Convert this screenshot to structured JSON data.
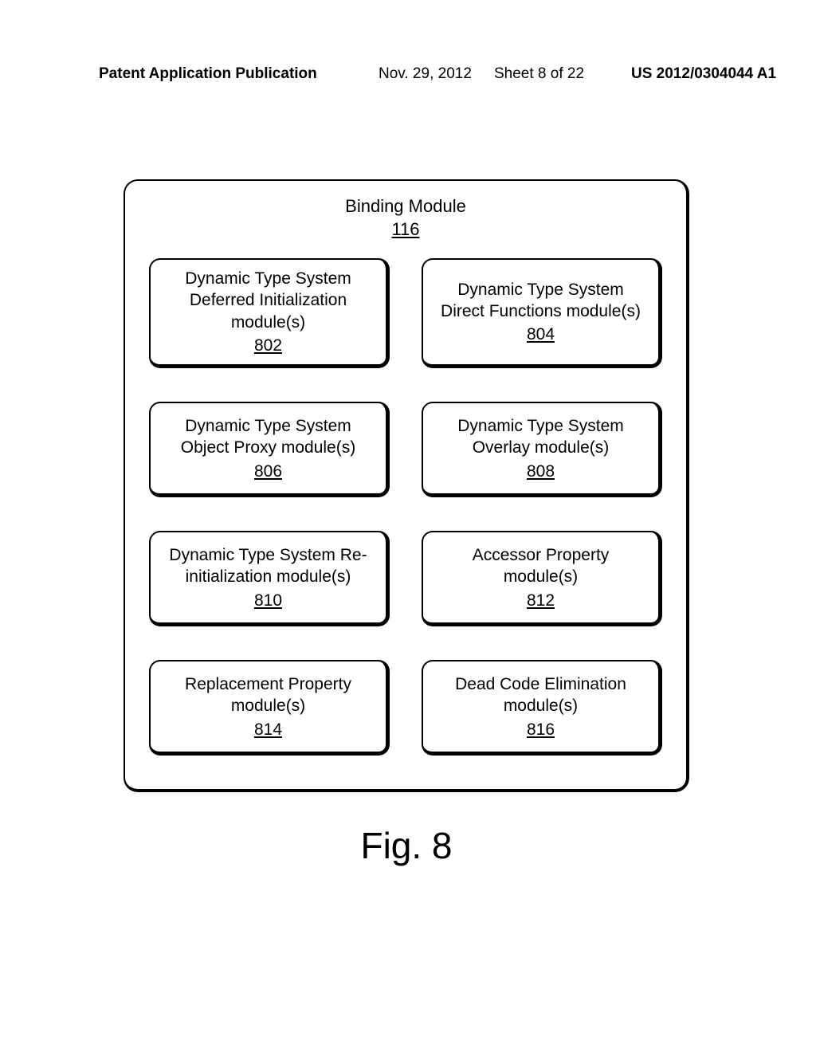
{
  "header": {
    "left": "Patent Application Publication",
    "date": "Nov. 29, 2012",
    "sheet": "Sheet 8 of 22",
    "pubno": "US 2012/0304044 A1"
  },
  "outer": {
    "title": "Binding Module",
    "ref": "116"
  },
  "modules": [
    {
      "lines": [
        "Dynamic Type System",
        "Deferred Initialization",
        "module(s)"
      ],
      "ref": "802"
    },
    {
      "lines": [
        "Dynamic Type System",
        "Direct Functions module(s)"
      ],
      "ref": "804"
    },
    {
      "lines": [
        "Dynamic Type System",
        "Object Proxy module(s)"
      ],
      "ref": "806"
    },
    {
      "lines": [
        "Dynamic Type System",
        "Overlay module(s)"
      ],
      "ref": "808"
    },
    {
      "lines": [
        "Dynamic Type System Re-",
        "initialization module(s)"
      ],
      "ref": "810"
    },
    {
      "lines": [
        "Accessor Property",
        "module(s)"
      ],
      "ref": "812"
    },
    {
      "lines": [
        "Replacement Property",
        "module(s)"
      ],
      "ref": "814"
    },
    {
      "lines": [
        "Dead Code Elimination",
        "module(s)"
      ],
      "ref": "816"
    }
  ],
  "figure_label": "Fig. 8"
}
